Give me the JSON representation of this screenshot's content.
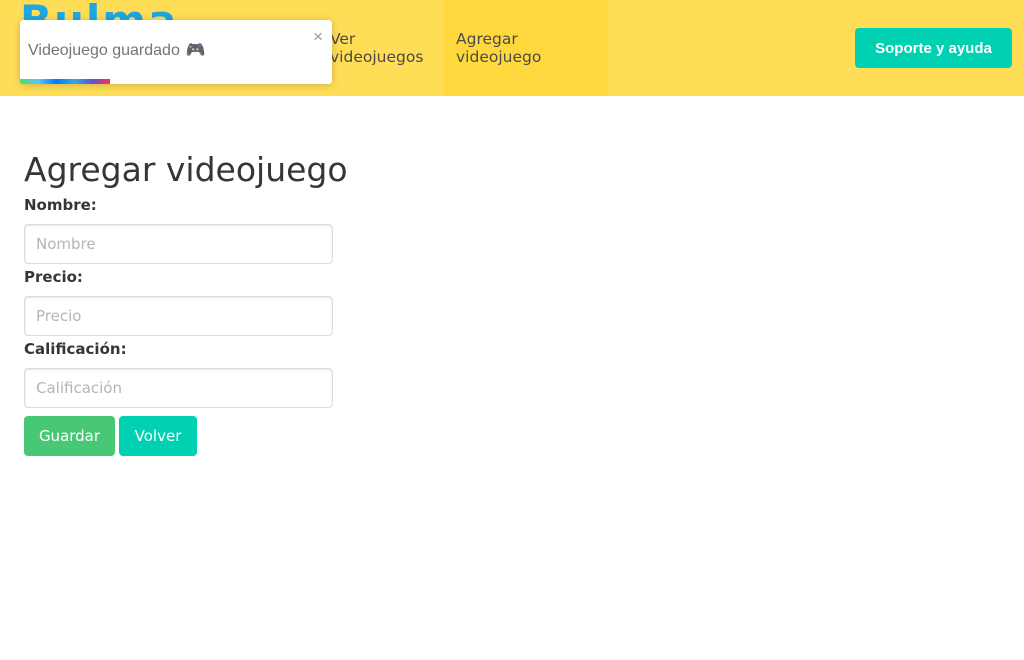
{
  "navbar": {
    "brand": "Bulma",
    "items": [
      {
        "label": "Ver videojuegos",
        "active": false
      },
      {
        "label": "Agregar videojuego",
        "active": true
      }
    ],
    "support_button": "Soporte y ayuda",
    "background": "#ffdd57",
    "accent": "#00d1b2"
  },
  "toast": {
    "message": "Videojuego guardado",
    "icon": "gamepad-icon",
    "icon_glyph": "🎮",
    "close_glyph": "×",
    "progress": 0.29
  },
  "form": {
    "title": "Agregar videojuego",
    "fields": [
      {
        "label": "Nombre:",
        "placeholder": "Nombre",
        "value": ""
      },
      {
        "label": "Precio:",
        "placeholder": "Precio",
        "value": ""
      },
      {
        "label": "Calificación:",
        "placeholder": "Calificación",
        "value": ""
      }
    ],
    "save_label": "Guardar",
    "back_label": "Volver",
    "save_color": "#48c774",
    "back_color": "#00d1b2"
  }
}
